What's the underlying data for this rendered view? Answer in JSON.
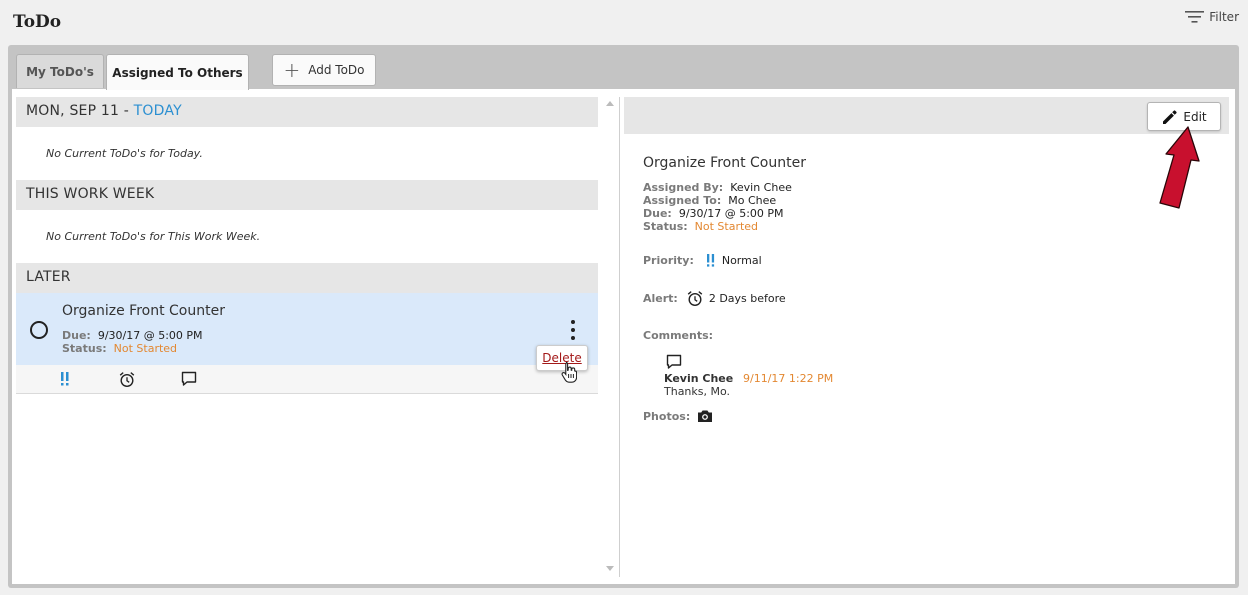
{
  "app": {
    "title": "ToDo"
  },
  "filter": {
    "label": "Filter",
    "icon": "filter-icon"
  },
  "tabs": [
    {
      "label": "My ToDo's",
      "active": false
    },
    {
      "label": "Assigned To Others",
      "active": true
    }
  ],
  "add_button": {
    "label": "Add ToDo",
    "icon": "plus-icon"
  },
  "sections": {
    "today": {
      "header": "MON, SEP 11 - ",
      "today_label": "TODAY",
      "empty": "No Current ToDo's for Today."
    },
    "week": {
      "header": "THIS WORK WEEK",
      "empty": "No Current ToDo's for This Work Week."
    },
    "later": {
      "header": "LATER"
    }
  },
  "todo": {
    "title": "Organize Front Counter",
    "due_label": "Due:",
    "due": "9/30/17 @ 5:00 PM",
    "status_label": "Status:",
    "status": "Not Started",
    "menu": {
      "delete_label": "Delete"
    },
    "icons": [
      "priority-icon",
      "alarm-clock-icon",
      "comment-icon"
    ]
  },
  "detail": {
    "edit_label": "Edit",
    "title": "Organize Front Counter",
    "assigned_by_label": "Assigned By:",
    "assigned_by": "Kevin Chee",
    "assigned_to_label": "Assigned To:",
    "assigned_to": "Mo Chee",
    "due_label": "Due:",
    "due": "9/30/17 @ 5:00 PM",
    "status_label": "Status:",
    "status": "Not Started",
    "priority_label": "Priority:",
    "priority": "Normal",
    "alert_label": "Alert:",
    "alert": "2 Days before",
    "comments_label": "Comments:",
    "comment": {
      "author": "Kevin Chee",
      "time": "9/11/17 1:22 PM",
      "text": "Thanks, Mo."
    },
    "photos_label": "Photos:"
  },
  "colors": {
    "accent_blue": "#2b8fd1",
    "status_orange": "#e38832",
    "delete_red": "#a31818",
    "selected_row": "#dae9fa",
    "annotation_arrow": "#c8102e"
  }
}
